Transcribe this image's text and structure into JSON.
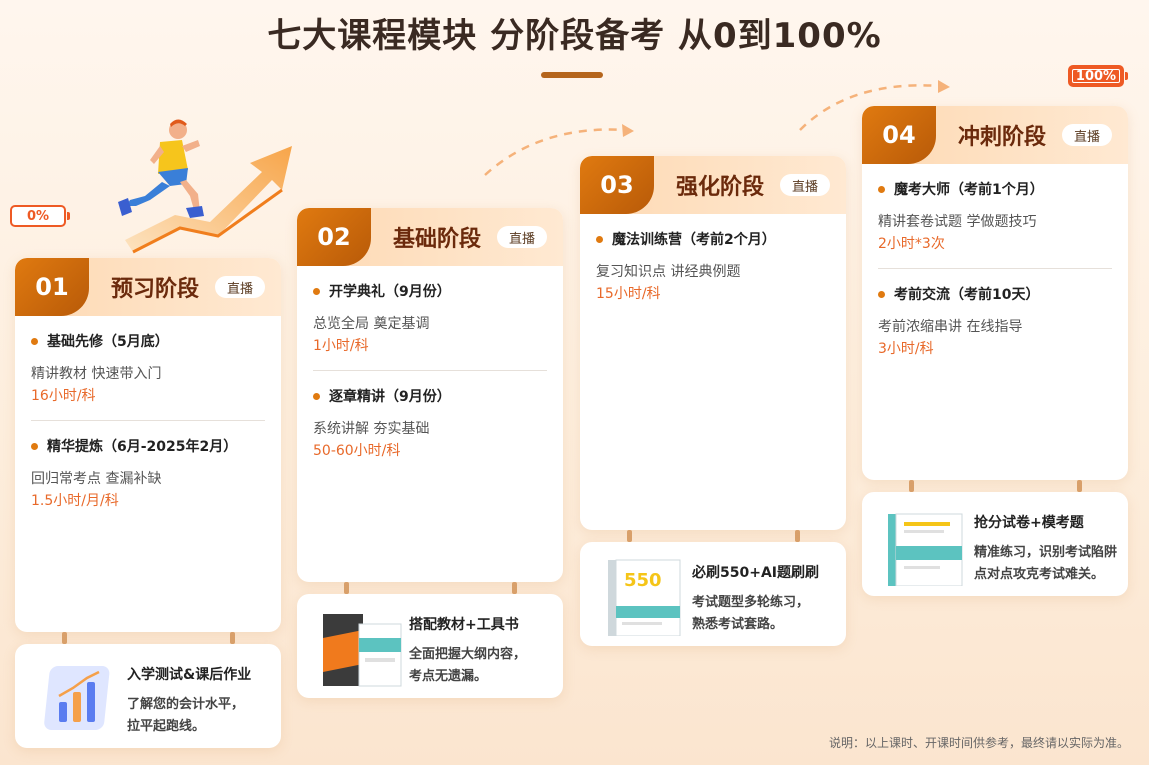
{
  "header": {
    "title": "七大课程模块 分阶段备考 从0到100%",
    "start_badge": "0%",
    "end_badge": "100%"
  },
  "stages": [
    {
      "num": "01",
      "name": "预习阶段",
      "tag": "直播",
      "items": [
        {
          "title": "基础先修（5月底）",
          "desc": "精讲教材 快速带入门",
          "time": "16小时/科"
        },
        {
          "title": "精华提炼（6月-2025年2月）",
          "desc": "回归常考点 查漏补缺",
          "time": "1.5小时/月/科"
        }
      ],
      "material": {
        "title": "入学测试&课后作业",
        "desc": [
          "了解您的会计水平，",
          "拉平起跑线。"
        ],
        "icon": "bar-chart-icon"
      }
    },
    {
      "num": "02",
      "name": "基础阶段",
      "tag": "直播",
      "items": [
        {
          "title": "开学典礼（9月份）",
          "desc": "总览全局 奠定基调",
          "time": "1小时/科"
        },
        {
          "title": "逐章精讲（9月份）",
          "desc": "系统讲解 夯实基础",
          "time": "50-60小时/科"
        }
      ],
      "material": {
        "title": "搭配教材+工具书",
        "desc": [
          "全面把握大纲内容，",
          "考点无遗漏。"
        ],
        "icon": "books-icon"
      }
    },
    {
      "num": "03",
      "name": "强化阶段",
      "tag": "直播",
      "items": [
        {
          "title": "魔法训练营（考前2个月）",
          "desc": "复习知识点 讲经典例题",
          "time": "15小时/科"
        }
      ],
      "material": {
        "title": "必刷550+AI题刷刷",
        "desc": [
          "考试题型多轮练习，",
          "熟悉考试套路。"
        ],
        "icon": "book-icon"
      }
    },
    {
      "num": "04",
      "name": "冲刺阶段",
      "tag": "直播",
      "items": [
        {
          "title": "魔考大师（考前1个月）",
          "desc": "精讲套卷试题 学做题技巧",
          "time": "2小时*3次"
        },
        {
          "title": "考前交流（考前10天）",
          "desc": "考前浓缩串讲 在线指导",
          "time": "3小时/科"
        }
      ],
      "material": {
        "title": "抢分试卷+模考题",
        "desc": [
          "精准练习，识别考试陷阱",
          "点对点攻克考试难关。"
        ],
        "icon": "exam-paper-icon"
      }
    }
  ],
  "footer": {
    "note": "说明：以上课时、开课时间供参考，最终请以实际为准。"
  },
  "colors": {
    "accent": "#e07a10",
    "time": "#e8692a",
    "title": "#6b2a0c"
  }
}
